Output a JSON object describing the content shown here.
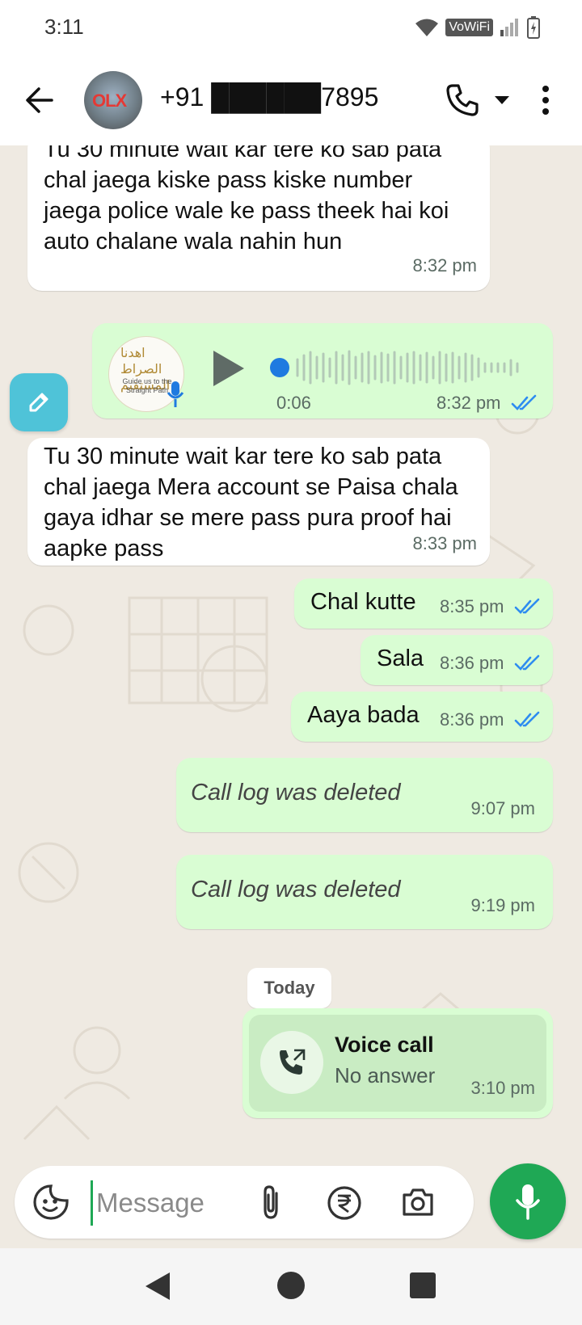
{
  "status": {
    "time": "3:11",
    "network_label": "VoWiFi",
    "icons": [
      "wifi-icon",
      "signal-icon",
      "battery-icon"
    ]
  },
  "header": {
    "contact_name": "+91 ██████7895",
    "avatar_logo_text": "OLX",
    "icons": [
      "back-arrow-icon",
      "phone-icon",
      "chevron-down-icon",
      "more-vert-icon"
    ]
  },
  "messages": [
    {
      "dir": "in",
      "text": "Tu 30 minute wait kar tere ko sab pata chal jaega kiske pass kiske number jaega police wale ke pass theek hai koi auto chalane wala nahin hun",
      "time": "8:32 pm"
    },
    {
      "dir": "out",
      "type": "voice",
      "duration": "0:06",
      "time": "8:32 pm",
      "thumb_title": "اهدنا الصراط المستقيم",
      "thumb_caption": "Guide us to the Straight Path"
    },
    {
      "dir": "in",
      "text": "Tu 30 minute wait kar tere ko sab pata chal jaega Mera account se Paisa chala gaya idhar se mere pass pura proof hai aapke pass",
      "time": "8:33 pm"
    },
    {
      "dir": "out",
      "text": "Chal kutte",
      "time": "8:35 pm"
    },
    {
      "dir": "out",
      "text": "Sala",
      "time": "8:36 pm"
    },
    {
      "dir": "out",
      "text": "Aaya bada",
      "time": "8:36 pm"
    },
    {
      "dir": "out",
      "type": "deleted",
      "text": "Call log was deleted",
      "time": "9:07 pm"
    },
    {
      "dir": "out",
      "type": "deleted",
      "text": "Call log was deleted",
      "time": "9:19 pm"
    },
    {
      "dir": "out",
      "type": "call",
      "title": "Voice call",
      "subtitle": "No answer",
      "time": "3:10 pm"
    }
  ],
  "date_chip": "Today",
  "composer": {
    "placeholder": "Message",
    "icons": [
      "sticker-icon",
      "attach-icon",
      "rupee-icon",
      "camera-icon",
      "mic-icon"
    ]
  },
  "colors": {
    "outgoing_bubble": "#d9fdd3",
    "incoming_bubble": "#ffffff",
    "chat_bg": "#efeae2",
    "accent_green": "#1fa855",
    "read_tick_blue": "#2e8cf0"
  },
  "navbar": {
    "icons": [
      "nav-back-icon",
      "nav-home-icon",
      "nav-recents-icon"
    ]
  }
}
